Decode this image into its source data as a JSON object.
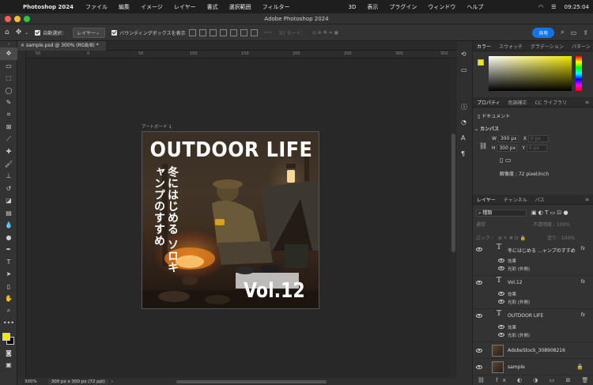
{
  "menubar": {
    "app_name": "Photoshop 2024",
    "items": [
      "ファイル",
      "編集",
      "イメージ",
      "レイヤー",
      "書式",
      "選択範囲",
      "フィルター",
      "3D",
      "表示",
      "プラグイン",
      "ウィンドウ",
      "ヘルプ"
    ],
    "clock": "09:25:04"
  },
  "window": {
    "title": "Adobe Photoshop 2024"
  },
  "options": {
    "auto_select_label": "自動選択：",
    "auto_select_value": "レイヤー",
    "bounding_box_label": "バウンディングボックスを表示",
    "mode3d_label": "3D モード：",
    "share_label": "共有"
  },
  "document": {
    "tab_title": "sample.psd @ 300% (RGB/8) *",
    "zoom": "300%",
    "doc_info": "300 px x 300 px (72 ppi)",
    "ruler_ticks": [
      "50",
      "0",
      "50",
      "100",
      "150",
      "200",
      "250",
      "300",
      "350"
    ]
  },
  "artboard": {
    "label": "アートボード 1",
    "headline": "OUTDOOR LIFE",
    "subtitle": "冬にはじめる ソロキャンプのすすめ",
    "vol": "Vol.12"
  },
  "color_panel": {
    "tabs": [
      "カラー",
      "スウォッチ",
      "グラデーション",
      "パターン"
    ],
    "foreground": "#f2e800",
    "background": "#000000"
  },
  "properties_panel": {
    "tabs": [
      "プロパティ",
      "色調補正",
      "CC ライブラリ"
    ],
    "doc_label": "ドキュメント",
    "canvas_label": "カンバス",
    "w_label": "W",
    "w_value": "300 px",
    "h_label": "H",
    "h_value": "300 px",
    "x_label": "X",
    "x_value": "0 px",
    "y_label": "Y",
    "y_value": "0 px",
    "resolution": "解像度 : 72 pixel/inch"
  },
  "layers_panel": {
    "tabs": [
      "レイヤー",
      "チャンネル",
      "パス"
    ],
    "kind_label": "種類",
    "blend_mode": "通常",
    "opacity": "不透明度 : 100%",
    "lock_label": "ロック :",
    "fill": "塗り : 100%",
    "layers": [
      {
        "name": "冬にはじめる …ャンプのすすめ",
        "type": "text",
        "effects": [
          "効果",
          "光彩 (外側)"
        ]
      },
      {
        "name": "Vol.12",
        "type": "text",
        "effects": [
          "効果",
          "光彩 (外側)"
        ]
      },
      {
        "name": "OUTDOOR LIFE",
        "type": "text",
        "effects": [
          "効果",
          "光彩 (外側)"
        ]
      },
      {
        "name": "AdobeStock_308908216",
        "type": "image",
        "effects": []
      },
      {
        "name": "sample",
        "type": "image",
        "effects": []
      }
    ],
    "fx_label": "fx"
  }
}
